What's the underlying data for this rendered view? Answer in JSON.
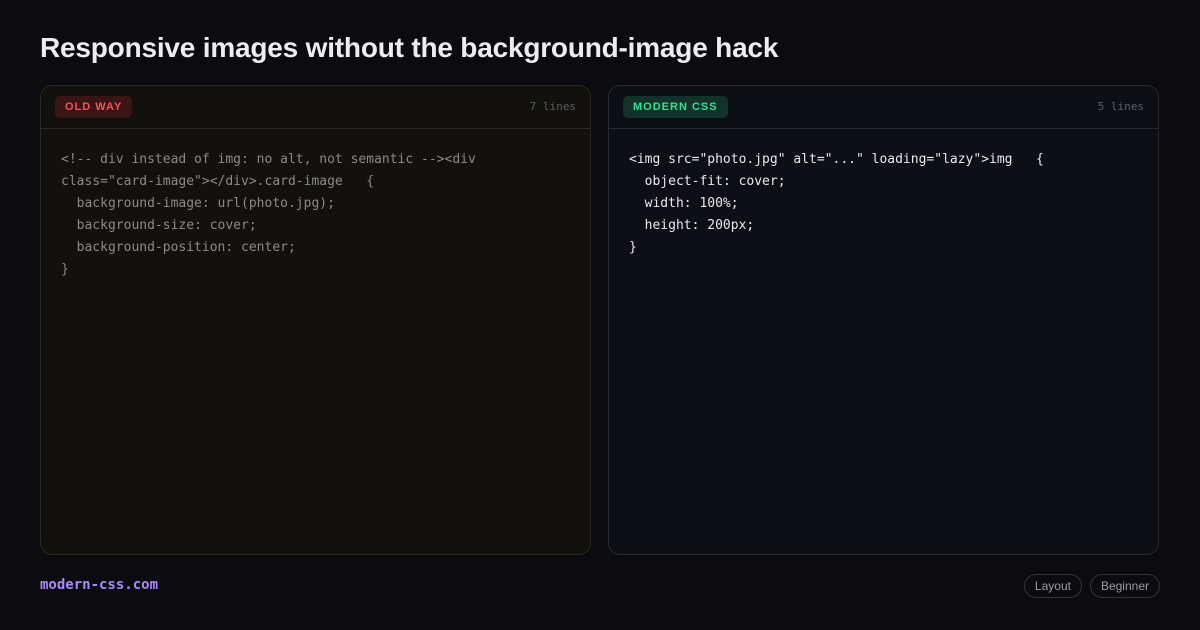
{
  "title": "Responsive images without the background-image hack",
  "old_panel": {
    "badge": "OLD WAY",
    "line_count": "7 lines",
    "code": "<!-- div instead of img: no alt, not semantic --><div\nclass=\"card-image\"></div>.card-image   {\n  background-image: url(photo.jpg);\n  background-size: cover;\n  background-position: center;\n}"
  },
  "new_panel": {
    "badge": "MODERN CSS",
    "line_count": "5 lines",
    "code": "<img src=\"photo.jpg\" alt=\"...\" loading=\"lazy\">img   {\n  object-fit: cover;\n  width: 100%;\n  height: 200px;\n}"
  },
  "footer": {
    "brand": "modern-css.com",
    "tags": [
      "Layout",
      "Beginner"
    ]
  },
  "colors": {
    "background": "#0b0b10",
    "old_accent": "#f0555a",
    "new_accent": "#3ddc97",
    "brand": "#a98bff"
  }
}
